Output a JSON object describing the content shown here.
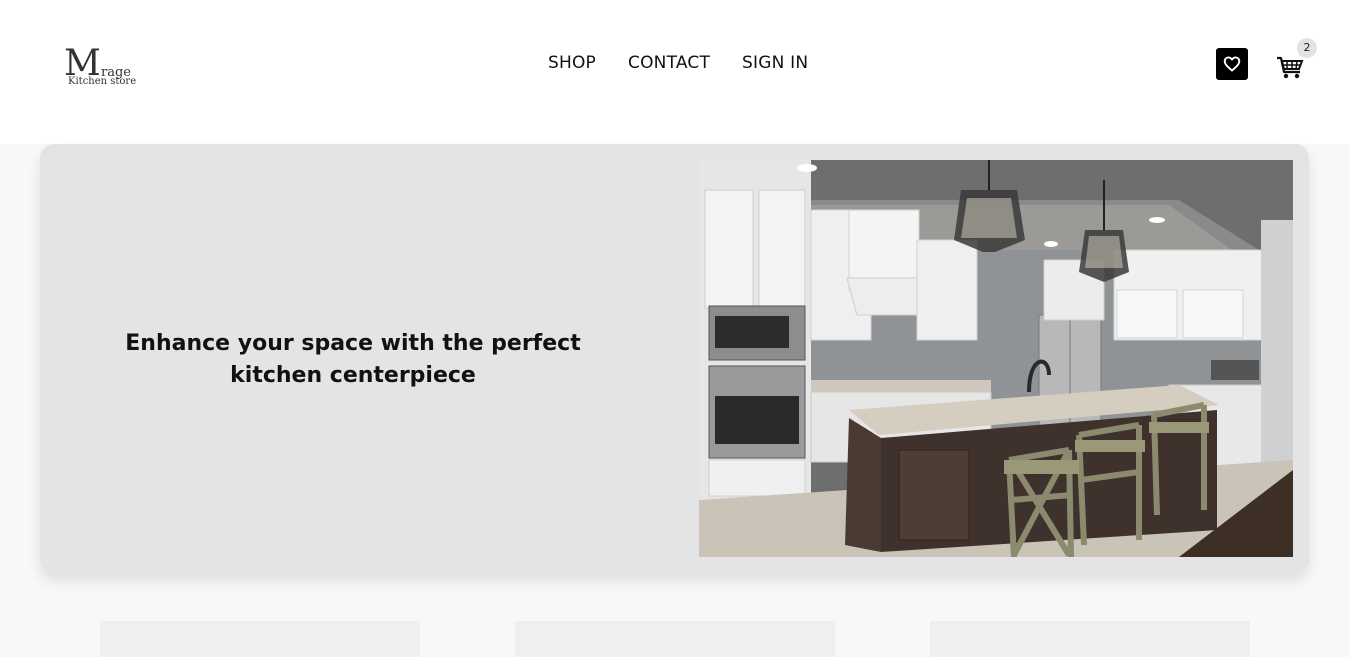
{
  "logo": {
    "big_letter": "M",
    "rest": "rage",
    "tagline": "Kitchen store"
  },
  "nav": {
    "shop": "SHOP",
    "contact": "CONTACT",
    "sign_in": "SIGN IN"
  },
  "header": {
    "wishlist_icon": "heart-icon",
    "cart_icon": "cart-icon",
    "cart_count": "2"
  },
  "hero": {
    "heading": "Enhance your space with the perfect kitchen centerpiece",
    "image": "kitchen-island-photo"
  },
  "colors": {
    "hero_bg": "#e4e4e7",
    "page_bg": "#f8f8f8",
    "icon_bg": "#000000"
  }
}
